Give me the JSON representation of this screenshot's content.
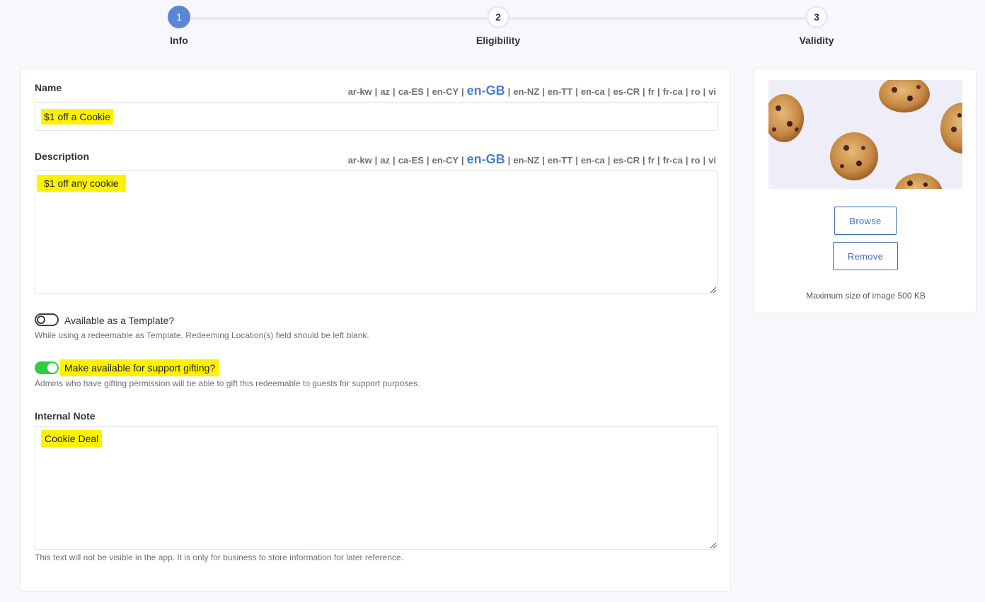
{
  "stepper": {
    "steps": [
      {
        "number": "1",
        "label": "Info",
        "state": "active"
      },
      {
        "number": "2",
        "label": "Eligibility",
        "state": "pending"
      },
      {
        "number": "3",
        "label": "Validity",
        "state": "pending"
      }
    ]
  },
  "languages": [
    "ar-kw",
    "az",
    "ca-ES",
    "en-CY",
    "en-GB",
    "en-NZ",
    "en-TT",
    "en-ca",
    "es-CR",
    "fr",
    "fr-ca",
    "ro",
    "vi"
  ],
  "active_language": "en-GB",
  "name_field": {
    "label": "Name",
    "value": "$1 off a Cookie"
  },
  "description_field": {
    "label": "Description",
    "value": "$1 off any cookie"
  },
  "template_toggle": {
    "label": "Available as a Template?",
    "checked": false,
    "helper": "While using a redeemable as Template, Redeeming Location(s) field should be left blank."
  },
  "gifting_toggle": {
    "label": "Make available for support gifting?",
    "checked": true,
    "helper": "Admins who have gifting permission will be able to gift this redeemable to guests for support purposes."
  },
  "internal_note": {
    "label": "Internal Note",
    "value": "Cookie Deal",
    "helper": "This text will not be visible in the app. It is only for business to store information for later reference."
  },
  "image_panel": {
    "browse_label": "Browse",
    "remove_label": "Remove",
    "note": "Maximum size of image 500 KB"
  },
  "colors": {
    "accent": "#5b86d6",
    "highlight": "#fff200",
    "toggle_on": "#2ecc40",
    "button_border": "#3f6fb6"
  }
}
